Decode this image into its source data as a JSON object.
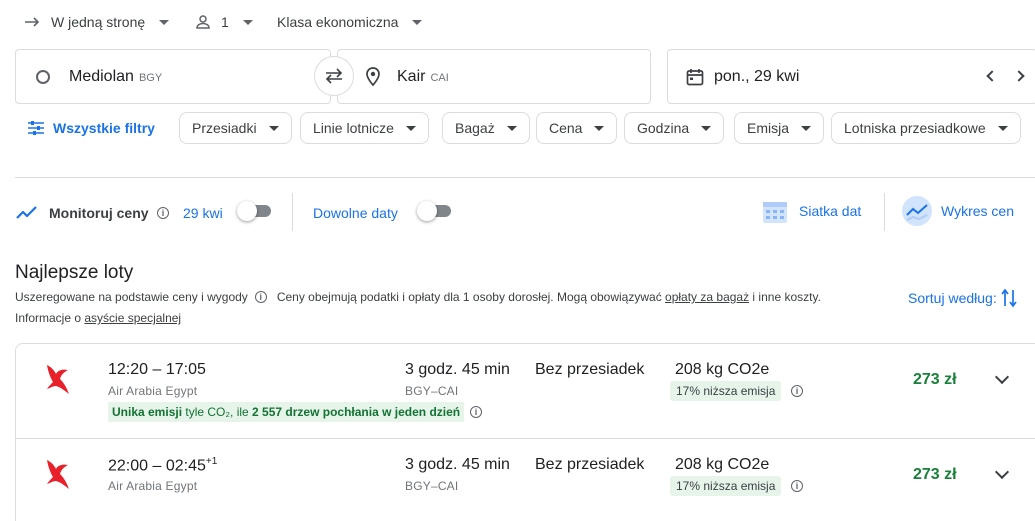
{
  "top": {
    "trip_type": "W jedną stronę",
    "passengers": "1",
    "cabin": "Klasa ekonomiczna"
  },
  "search": {
    "origin": "Mediolan",
    "origin_code": "BGY",
    "destination": "Kair",
    "destination_code": "CAI",
    "date": "pon., 29 kwi"
  },
  "filters": {
    "all_label": "Wszystkie filtry",
    "chips": [
      "Przesiadki",
      "Linie lotnicze",
      "Bagaż",
      "Cena",
      "Godzina",
      "Emisja",
      "Lotniska przesiadkowe"
    ]
  },
  "tools": {
    "monitor_label": "Monitoruj ceny",
    "monitor_date": "29 kwi",
    "any_dates_label": "Dowolne daty",
    "date_grid_label": "Siatka dat",
    "price_graph_label": "Wykres cen"
  },
  "results": {
    "heading": "Najlepsze loty",
    "note_sort": "Uszeregowane na podstawie ceny i wygody",
    "note_prices_a": "Ceny obejmują podatki i opłaty dla 1 osoby dorosłej. Mogą obowiązywać ",
    "note_fees_link": "opłaty za bagaż",
    "note_prices_b": " i inne koszty.",
    "note_assist_a": "Informacje o ",
    "note_assist_link": "asyście specjalnej",
    "sort_label": "Sortuj według:"
  },
  "flights": [
    {
      "times": "12:20 – 17:05",
      "day_offset": "",
      "airline": "Air Arabia Egypt",
      "duration": "3 godz. 45 min",
      "route": "BGY–CAI",
      "stops": "Bez przesiadek",
      "emissions": "208 kg CO2e",
      "emission_badge": "17% niższa emisja",
      "price": "273 zł",
      "eco_strong": "Unika emisji",
      "eco_mid": " tyle CO₂, ile ",
      "eco_trees": "2 557 drzew pochłania w jeden dzień"
    },
    {
      "times": "22:00 – 02:45",
      "day_offset": "+1",
      "airline": "Air Arabia Egypt",
      "duration": "3 godz. 45 min",
      "route": "BGY–CAI",
      "stops": "Bez przesiadek",
      "emissions": "208 kg CO2e",
      "emission_badge": "17% niższa emisja",
      "price": "273 zł"
    }
  ],
  "colors": {
    "accent": "#1a73e8",
    "price_green": "#188038",
    "badge_green_bg": "#e6f4ea",
    "airline_red": "#e8202a"
  }
}
